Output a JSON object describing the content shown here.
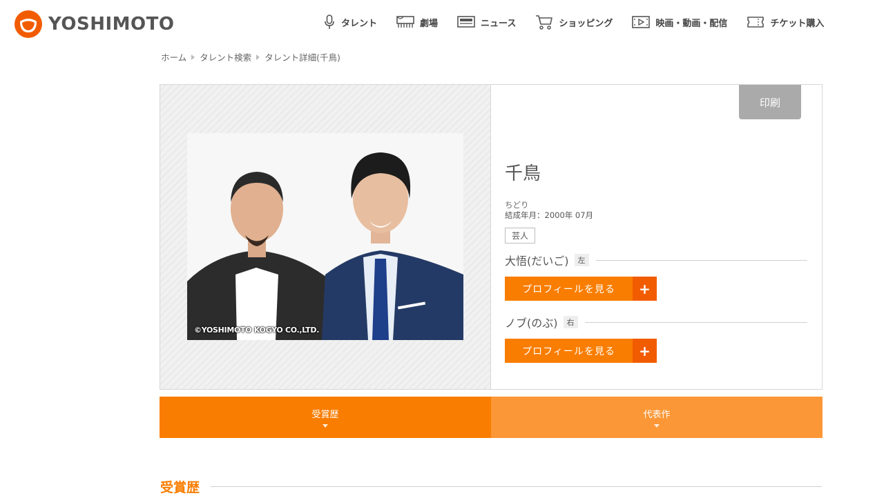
{
  "brand": {
    "name": "YOSHIMOTO"
  },
  "nav": [
    {
      "label": "タレント",
      "icon": "microphone-icon"
    },
    {
      "label": "劇場",
      "icon": "theater-icon"
    },
    {
      "label": "ニュース",
      "icon": "news-icon"
    },
    {
      "label": "ショッピング",
      "icon": "cart-icon"
    },
    {
      "label": "映画・動画・配信",
      "icon": "film-icon"
    },
    {
      "label": "チケット購入",
      "icon": "ticket-icon"
    }
  ],
  "breadcrumb": [
    "ホーム",
    "タレント検索",
    "タレント詳細(千鳥)"
  ],
  "photo": {
    "copyright": "©YOSHIMOTO KOGYO CO.,LTD."
  },
  "profile": {
    "print_label": "印刷",
    "name": "千鳥",
    "kana": "ちどり",
    "formed": "結成年月：2000年 07月",
    "tag": "芸人",
    "members": [
      {
        "name": "大悟(だいご)",
        "position": "左",
        "button": "プロフィールを見る"
      },
      {
        "name": "ノブ(のぶ)",
        "position": "右",
        "button": "プロフィールを見る"
      }
    ]
  },
  "tabs": [
    {
      "label": "受賞歴"
    },
    {
      "label": "代表作"
    }
  ],
  "section": {
    "title": "受賞歴"
  },
  "colors": {
    "accent": "#f97d00",
    "accent_dark": "#f25c00",
    "tab_light": "#fb9736",
    "print": "#aaaaaa"
  }
}
